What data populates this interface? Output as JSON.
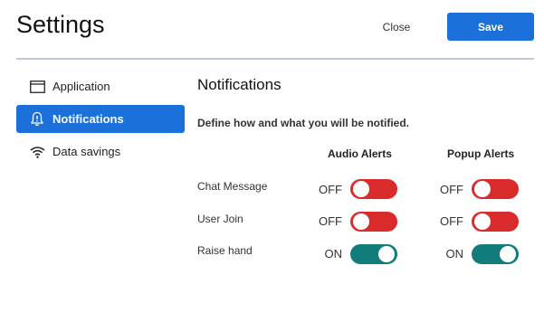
{
  "header": {
    "title": "Settings",
    "close_label": "Close",
    "save_label": "Save"
  },
  "sidebar": {
    "items": [
      {
        "label": "Application",
        "icon": "window-icon"
      },
      {
        "label": "Notifications",
        "icon": "bell-icon",
        "active": true
      },
      {
        "label": "Data savings",
        "icon": "wifi-icon"
      }
    ]
  },
  "main": {
    "title": "Notifications",
    "description": "Define how and what you will be notified.",
    "columns": {
      "audio": "Audio Alerts",
      "popup": "Popup Alerts"
    },
    "rows": [
      {
        "label": "Chat Message",
        "audio": "OFF",
        "popup": "OFF"
      },
      {
        "label": "User Join",
        "audio": "OFF",
        "popup": "OFF"
      },
      {
        "label": "Raise hand",
        "audio": "ON",
        "popup": "ON"
      }
    ]
  },
  "colors": {
    "accent": "#1b70d9",
    "toggle_off": "#d92b2b",
    "toggle_on": "#127c7a"
  }
}
